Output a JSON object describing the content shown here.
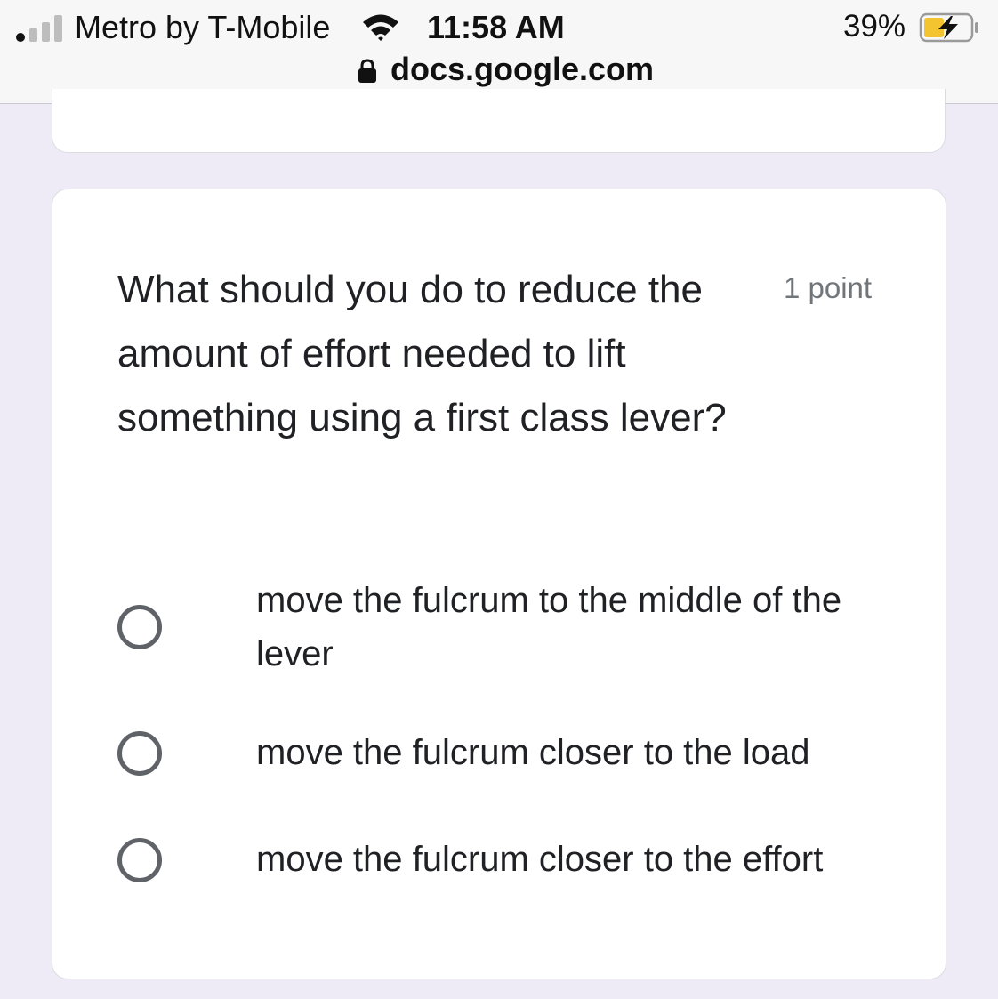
{
  "status_bar": {
    "carrier": "Metro by T-Mobile",
    "time": "11:58 AM",
    "battery_percent": "39%",
    "url": "docs.google.com",
    "icons": [
      "signal-icon",
      "wifi-icon",
      "battery-charging-icon",
      "lock-icon"
    ]
  },
  "question": {
    "text": "What should you do to reduce the amount of effort needed to lift something using a first class lever?",
    "points": "1 point",
    "options": [
      {
        "label": "move the fulcrum to the middle of the lever",
        "selected": false
      },
      {
        "label": "move the fulcrum closer to the load",
        "selected": false
      },
      {
        "label": "move the fulcrum closer to the effort",
        "selected": false
      }
    ]
  },
  "colors": {
    "page_background": "#eeebf6",
    "card_background": "#ffffff",
    "radio_border": "#5f6368",
    "battery_fill": "#f4c430"
  }
}
